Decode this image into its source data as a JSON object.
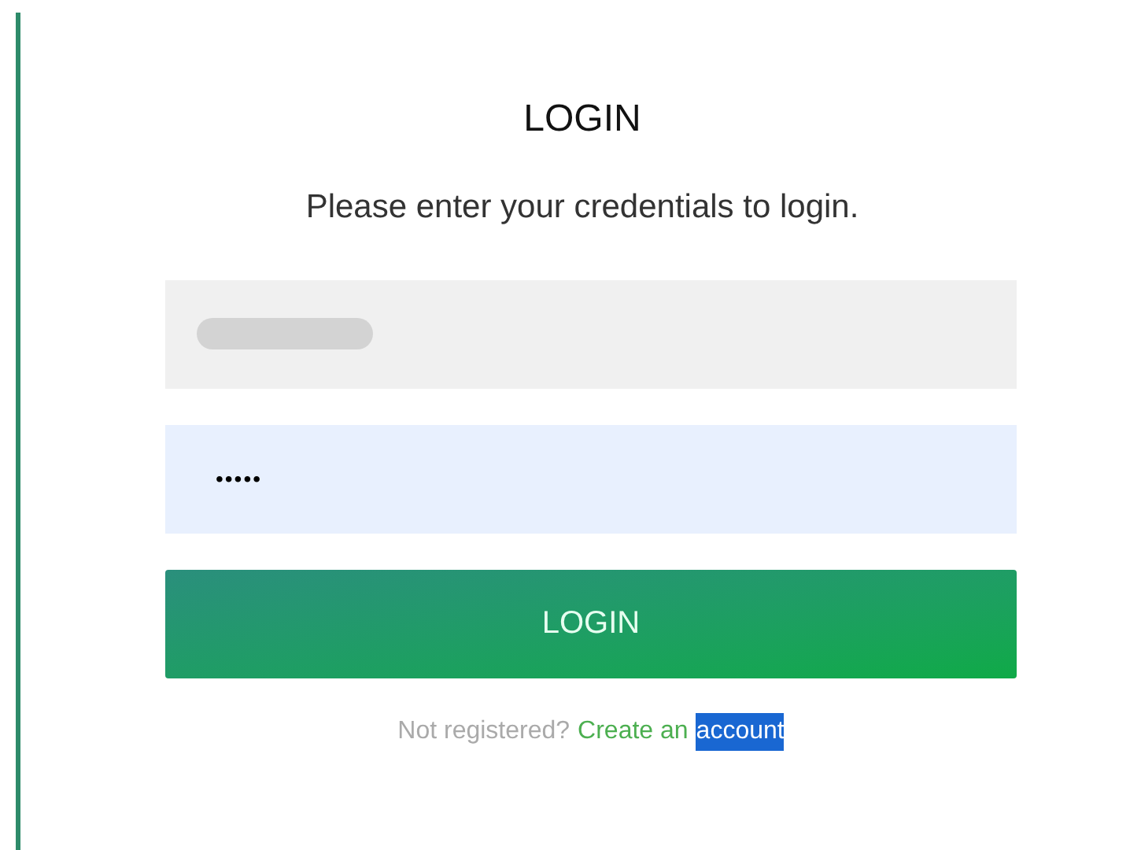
{
  "title": "LOGIN",
  "subtitle": "Please enter your credentials to login.",
  "username": {
    "redacted": true
  },
  "password": {
    "value": "•••••",
    "focused": true
  },
  "button": "LOGIN",
  "footer": {
    "prompt": "Not registered?",
    "link_parts": [
      {
        "text": "Create an",
        "selected": false
      },
      {
        "text": "account",
        "selected": true
      }
    ]
  }
}
